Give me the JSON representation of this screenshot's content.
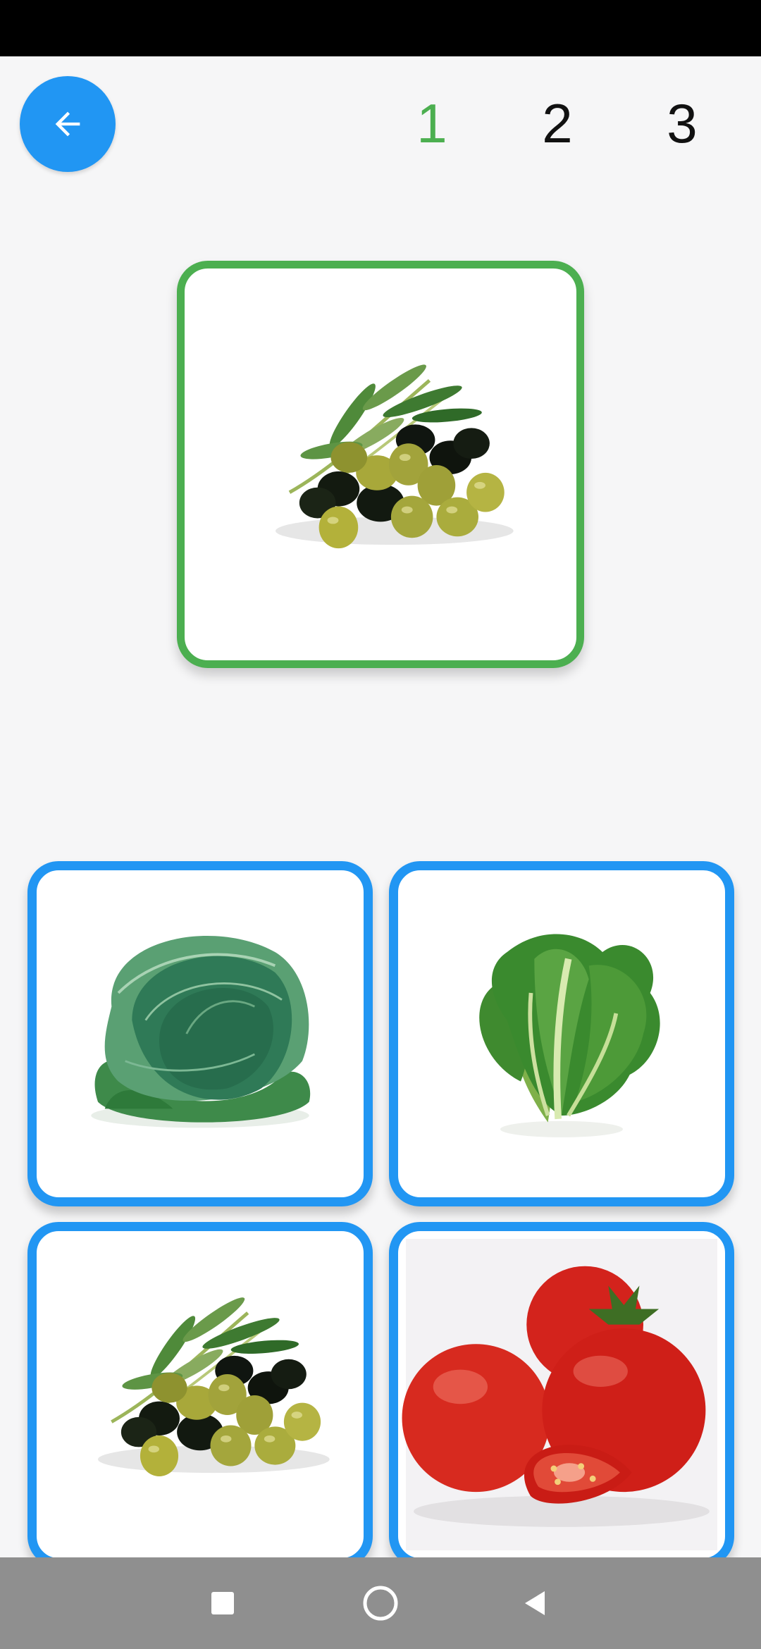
{
  "header": {
    "back_icon": "arrow-left-icon",
    "steps": [
      {
        "label": "1",
        "active": true
      },
      {
        "label": "2",
        "active": false
      },
      {
        "label": "3",
        "active": false
      }
    ]
  },
  "colors": {
    "accent_blue": "#2196F3",
    "accent_green": "#4CAF50",
    "status_bar": "#000000",
    "nav_bar": "#8f8f8f"
  },
  "target": {
    "image": "olives-illustration"
  },
  "options": [
    {
      "image": "cabbage-illustration"
    },
    {
      "image": "lettuce-illustration"
    },
    {
      "image": "olives-illustration"
    },
    {
      "image": "tomatoes-illustration"
    }
  ],
  "system_nav": {
    "recent_icon": "square-icon",
    "home_icon": "circle-icon",
    "back_icon": "triangle-back-icon"
  }
}
